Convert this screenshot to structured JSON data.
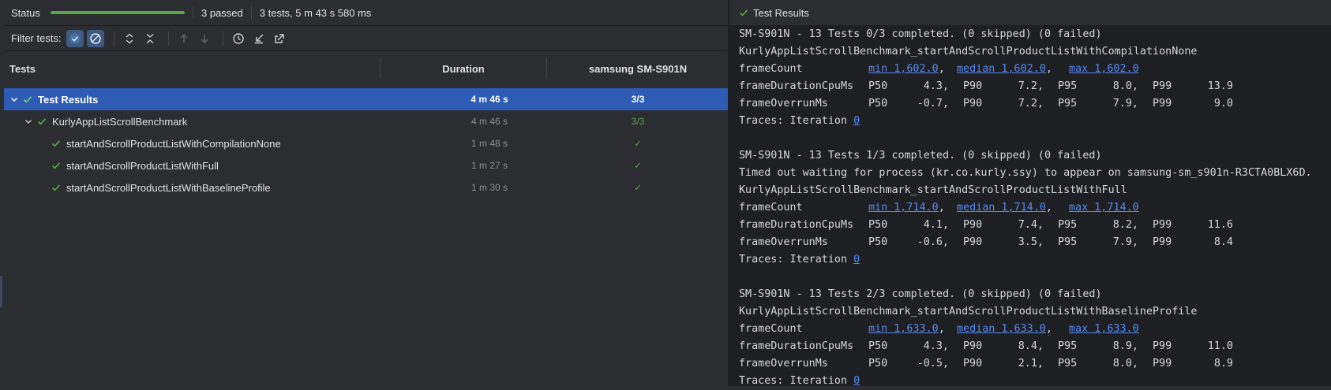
{
  "status": {
    "label": "Status",
    "progress": 1.0,
    "passed": "3 passed",
    "summary": "3 tests, 5 m 43 s 580 ms"
  },
  "filter": {
    "label": "Filter tests:"
  },
  "table": {
    "col_tests": "Tests",
    "col_duration": "Duration",
    "col_device": "samsung SM-S901N"
  },
  "rows": [
    {
      "name": "Test Results",
      "duration": "4 m 46 s",
      "result": "3/3"
    },
    {
      "name": "KurlyAppListScrollBenchmark",
      "duration": "4 m 46 s",
      "result": "3/3"
    },
    {
      "name": "startAndScrollProductListWithCompilationNone",
      "duration": "1 m 48 s",
      "result": "✓"
    },
    {
      "name": "startAndScrollProductListWithFull",
      "duration": "1 m 27 s",
      "result": "✓"
    },
    {
      "name": "startAndScrollProductListWithBaselineProfile",
      "duration": "1 m 30 s",
      "result": "✓"
    }
  ],
  "right": {
    "title": "Test Results"
  },
  "console": {
    "blocks": [
      {
        "header": "SM-S901N - 13 Tests 0/3 completed. (0 skipped) (0 failed)",
        "extra": "",
        "test": "KurlyAppListScrollBenchmark_startAndScrollProductListWithCompilationNone",
        "frameCount": {
          "label": "frameCount",
          "min": "min 1,602.0",
          "median": "median 1,602.0",
          "max": "max 1,602.0"
        },
        "cpu": {
          "label": "frameDurationCpuMs",
          "p50": "4.3,",
          "p90": "7.2,",
          "p95": "8.0,",
          "p99": "13.9"
        },
        "overrun": {
          "label": "frameOverrunMs",
          "p50": "-0.7,",
          "p90": "7.2,",
          "p95": "7.9,",
          "p99": "9.0"
        },
        "traces": "Traces: Iteration ",
        "traces_link": "0"
      },
      {
        "header": "SM-S901N - 13 Tests 1/3 completed. (0 skipped) (0 failed)",
        "extra": "Timed out waiting for process (kr.co.kurly.ssy) to appear on samsung-sm_s901n-R3CTA0BLX6D.",
        "test": "KurlyAppListScrollBenchmark_startAndScrollProductListWithFull",
        "frameCount": {
          "label": "frameCount",
          "min": "min 1,714.0",
          "median": "median 1,714.0",
          "max": "max 1,714.0"
        },
        "cpu": {
          "label": "frameDurationCpuMs",
          "p50": "4.1,",
          "p90": "7.4,",
          "p95": "8.2,",
          "p99": "11.6"
        },
        "overrun": {
          "label": "frameOverrunMs",
          "p50": "-0.6,",
          "p90": "3.5,",
          "p95": "7.9,",
          "p99": "8.4"
        },
        "traces": "Traces: Iteration ",
        "traces_link": "0"
      },
      {
        "header": "SM-S901N - 13 Tests 2/3 completed. (0 skipped) (0 failed)",
        "extra": "",
        "test": "KurlyAppListScrollBenchmark_startAndScrollProductListWithBaselineProfile",
        "frameCount": {
          "label": "frameCount",
          "min": "min 1,633.0",
          "median": "median 1,633.0",
          "max": "max 1,633.0"
        },
        "cpu": {
          "label": "frameDurationCpuMs",
          "p50": "4.3,",
          "p90": "8.4,",
          "p95": "8.9,",
          "p99": "11.0"
        },
        "overrun": {
          "label": "frameOverrunMs",
          "p50": "-0.5,",
          "p90": "2.1,",
          "p95": "8.0,",
          "p99": "8.9"
        },
        "traces": "Traces: Iteration ",
        "traces_link": "0"
      }
    ],
    "percentile_labels": [
      "P50",
      "P90",
      "P95",
      "P99"
    ]
  },
  "colors": {
    "pass": "#57a64a",
    "selection": "#2e5cb5",
    "link": "#548af7"
  }
}
